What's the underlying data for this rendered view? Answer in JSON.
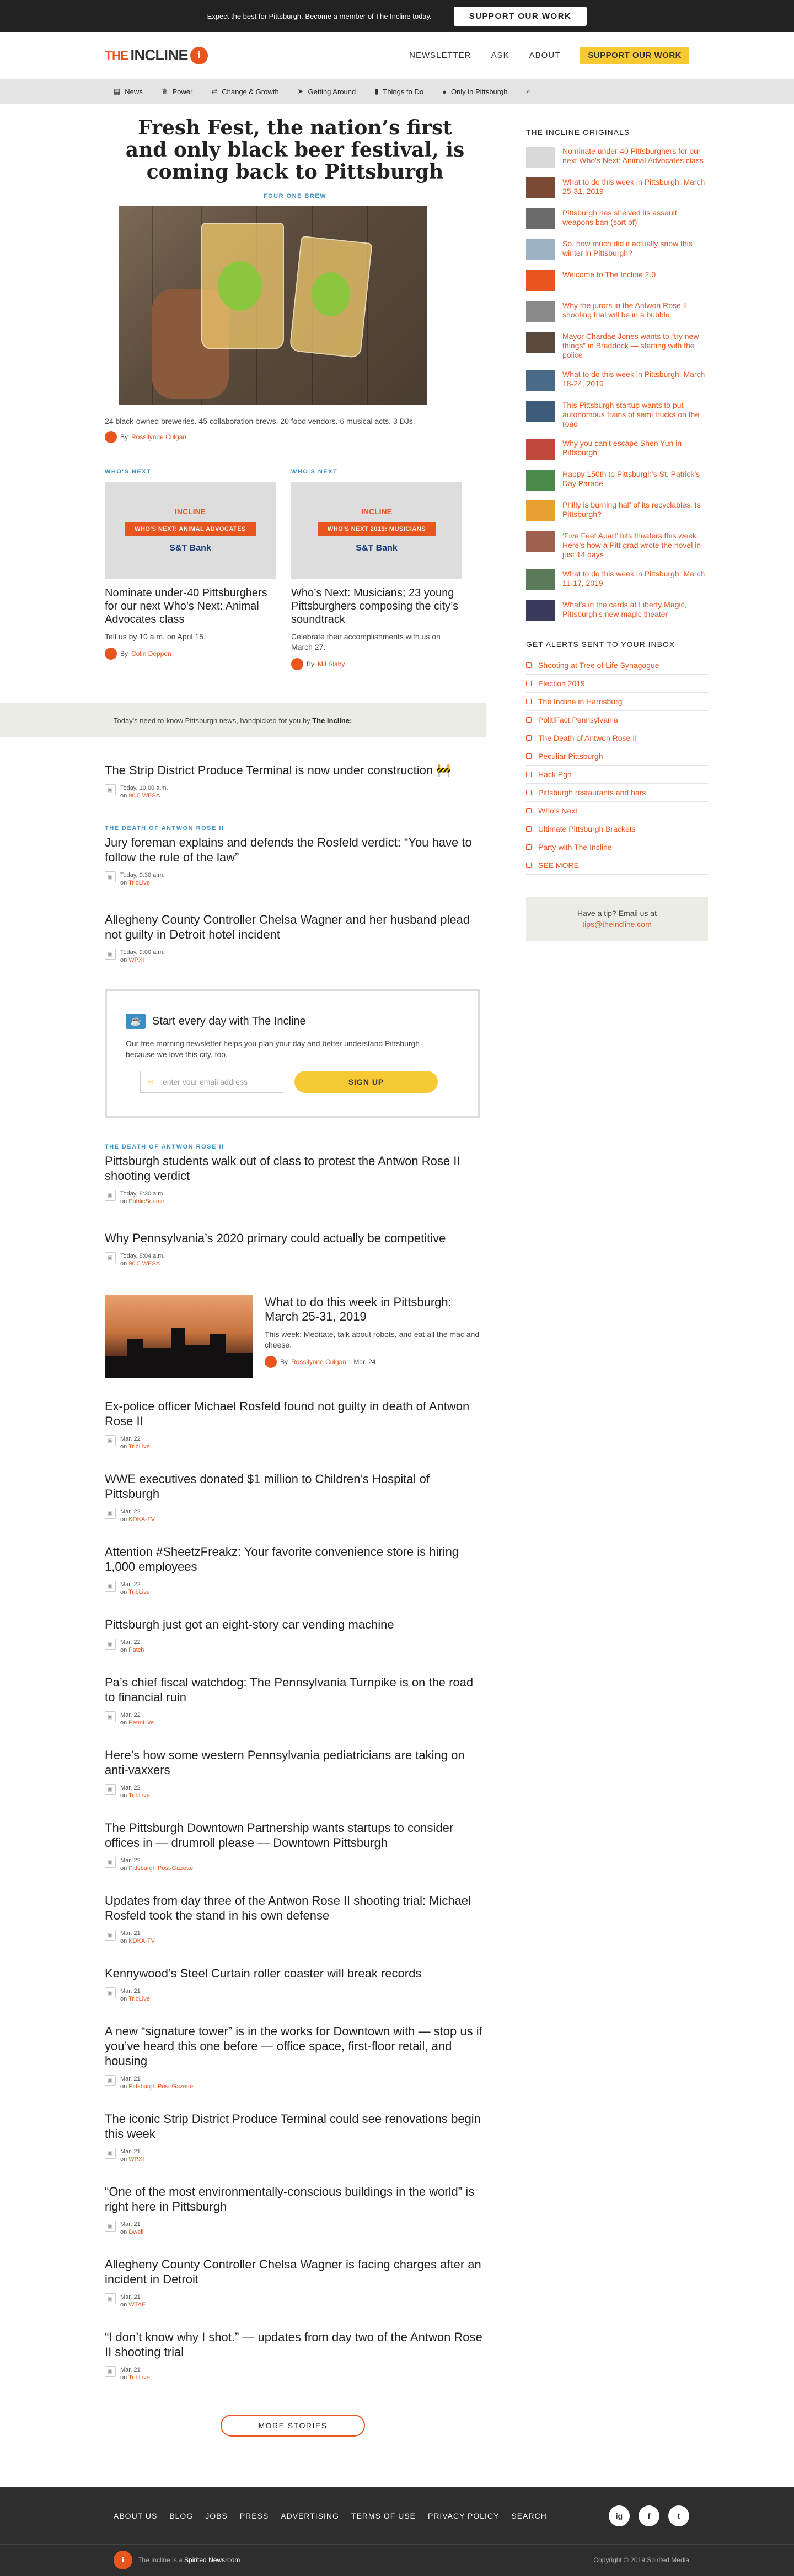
{
  "topbar": {
    "message": "Expect the best for Pittsburgh. Become a member of The Incline today.",
    "button": "Support Our Work"
  },
  "header": {
    "logo_the": "THE",
    "logo_name": "INCLINE",
    "logo_badge": "i",
    "nav": [
      "NEWSLETTER",
      "ASK",
      "ABOUT"
    ],
    "support": "SUPPORT OUR WORK"
  },
  "catnav": [
    {
      "icon": "news-icon",
      "glyph": "▤",
      "label": "News"
    },
    {
      "icon": "power-icon",
      "glyph": "♛",
      "label": "Power"
    },
    {
      "icon": "change-icon",
      "glyph": "⇄",
      "label": "Change & Growth"
    },
    {
      "icon": "getting-around-icon",
      "glyph": "➤",
      "label": "Getting Around"
    },
    {
      "icon": "things-to-do-icon",
      "glyph": "▮",
      "label": "Things to Do"
    },
    {
      "icon": "pittsburgh-icon",
      "glyph": "●",
      "label": "Only in Pittsburgh"
    },
    {
      "icon": "search-icon",
      "glyph": "⌕",
      "label": ""
    }
  ],
  "hero": {
    "title": "Fresh Fest, the nation’s first and only black beer festival, is coming back to Pittsburgh",
    "kicker": "FOUR ONE BREW",
    "description": "24 black-owned breweries. 45 collaboration brews. 20 food vendors. 6 musical acts. 3 DJs.",
    "by": "By",
    "author": "Rossilynne Culgan"
  },
  "whos_next": [
    {
      "kicker": "WHO'S NEXT",
      "banner": "WHO'S NEXT: ANIMAL ADVOCATES",
      "sponsor": "S&T Bank",
      "title": "Nominate under-40 Pittsburghers for our next Who’s Next: Animal Advocates class",
      "desc": "Tell us by 10 a.m. on April 15.",
      "author": "Colin Deppen"
    },
    {
      "kicker": "WHO'S NEXT",
      "banner": "WHO'S NEXT 2019: MUSICIANS",
      "sponsor": "S&T Bank",
      "title": "Who’s Next: Musicians; 23 young Pittsburghers composing the city’s soundtrack",
      "desc": "Celebrate their accomplishments with us on March 27.",
      "author": "MJ Slaby"
    }
  ],
  "promo": {
    "text": "Today's need-to-know Pittsburgh news, handpicked for you by ",
    "brand": "The Incline:"
  },
  "stories_a": [
    {
      "kicker": "",
      "title": "The Strip District Produce Terminal is now under construction 🚧",
      "time": "Today, 10:00 a.m.",
      "src": "90.5 WESA"
    },
    {
      "kicker": "THE DEATH OF ANTWON ROSE II",
      "title": "Jury foreman explains and defends the Rosfeld verdict: “You have to follow the rule of the law”",
      "time": "Today, 9:30 a.m.",
      "src": "TribLive"
    },
    {
      "kicker": "",
      "title": "Allegheny County Controller Chelsa Wagner and her husband plead not guilty in Detroit hotel incident",
      "time": "Today, 9:00 a.m.",
      "src": "WPXI"
    }
  ],
  "newsletter": {
    "title": "Start every day with The Incline",
    "text": "Our free morning newsletter helps you plan your day and better understand Pittsburgh — because we love this city, too.",
    "placeholder": "enter your email address",
    "button": "SIGN UP"
  },
  "stories_b": [
    {
      "kicker": "THE DEATH OF ANTWON ROSE II",
      "title": "Pittsburgh students walk out of class to protest the Antwon Rose II shooting verdict",
      "time": "Today, 8:30 a.m.",
      "src": "PublicSource"
    },
    {
      "kicker": "",
      "title": "Why Pennsylvania’s 2020 primary could actually be competitive",
      "time": "Today, 8:04 a.m.",
      "src": "90.5 WESA"
    }
  ],
  "feature": {
    "title": "What to do this week in Pittsburgh: March 25-31, 2019",
    "desc": "This week: Meditate, talk about robots, and eat all the mac and cheese.",
    "author": "Rossilynne Culgan",
    "date": "Mar. 24"
  },
  "stories_c": [
    {
      "title": "Ex-police officer Michael Rosfeld found not guilty in death of Antwon Rose II",
      "time": "Mar. 22",
      "src": "TribLive"
    },
    {
      "title": "WWE executives donated $1 million to Children’s Hospital of Pittsburgh",
      "time": "Mar. 22",
      "src": "KDKA-TV"
    },
    {
      "title": "Attention #SheetzFreakz: Your favorite convenience store is hiring 1,000 employees",
      "time": "Mar. 22",
      "src": "TribLive"
    },
    {
      "title": "Pittsburgh just got an eight-story car vending machine",
      "time": "Mar. 22",
      "src": "Patch"
    },
    {
      "title": "Pa’s chief fiscal watchdog: The Pennsylvania Turnpike is on the road to financial ruin",
      "time": "Mar. 22",
      "src": "PennLive"
    },
    {
      "title": "Here’s how some western Pennsylvania pediatricians are taking on anti-vaxxers",
      "time": "Mar. 22",
      "src": "TribLive"
    },
    {
      "title": "The Pittsburgh Downtown Partnership wants startups to consider offices in — drumroll please — Downtown Pittsburgh",
      "time": "Mar. 22",
      "src": "Pittsburgh Post-Gazette"
    },
    {
      "title": "Updates from day three of the Antwon Rose II shooting trial: Michael Rosfeld took the stand in his own defense",
      "time": "Mar. 21",
      "src": "KDKA-TV"
    },
    {
      "title": "Kennywood’s Steel Curtain roller coaster will break records",
      "time": "Mar. 21",
      "src": "TribLive"
    },
    {
      "title": "A new “signature tower” is in the works for Downtown with — stop us if you’ve heard this one before — office space, first-floor retail, and housing",
      "time": "Mar. 21",
      "src": "Pittsburgh Post-Gazette"
    },
    {
      "title": "The iconic Strip District Produce Terminal could see renovations begin this week",
      "time": "Mar. 21",
      "src": "WPXI"
    },
    {
      "title": "“One of the most environmentally-conscious buildings in the world” is right here in Pittsburgh",
      "time": "Mar. 21",
      "src": "Dwell"
    },
    {
      "title": "Allegheny County Controller Chelsa Wagner is facing charges after an incident in Detroit",
      "time": "Mar. 21",
      "src": "WTAE"
    },
    {
      "title": "“I don’t know why I shot.” — updates from day two of the Antwon Rose II shooting trial",
      "time": "Mar. 21",
      "src": "TribLive"
    }
  ],
  "more_button": "MORE STORIES",
  "sidebar": {
    "originals_title": "THE INCLINE ORIGINALS",
    "originals": [
      {
        "title": "Nominate under-40 Pittsburghers for our next Who’s Next: Animal Advocates class",
        "color": "#d9d9d9"
      },
      {
        "title": "What to do this week in Pittsburgh: March 25-31, 2019",
        "color": "#7a4a34"
      },
      {
        "title": "Pittsburgh has shelved its assault weapons ban (sort of)",
        "color": "#6b6b6b"
      },
      {
        "title": "So, how much did it actually snow this winter in Pittsburgh?",
        "color": "#9eb2c5"
      },
      {
        "title": "Welcome to The Incline 2.0",
        "color": "#e8551f"
      },
      {
        "title": "Why the jurors in the Antwon Rose II shooting trial will be in a bubble",
        "color": "#8a8a8a"
      },
      {
        "title": "Mayor Chardae Jones wants to “try new things” in Braddock — starting with the police",
        "color": "#5a4a3e"
      },
      {
        "title": "What to do this week in Pittsburgh: March 18-24, 2019",
        "color": "#4a6a8a"
      },
      {
        "title": "This Pittsburgh startup wants to put autonomous trains of semi trucks on the road",
        "color": "#3c5c7a"
      },
      {
        "title": "Why you can’t escape Shen Yun in Pittsburgh",
        "color": "#c04a3a"
      },
      {
        "title": "Happy 150th to Pittsburgh’s St. Patrick’s Day Parade",
        "color": "#4a8a4a"
      },
      {
        "title": "Philly is burning half of its recyclables. Is Pittsburgh?",
        "color": "#e8a030"
      },
      {
        "title": "‘Five Feet Apart’ hits theaters this week. Here’s how a Pitt grad wrote the novel in just 14 days",
        "color": "#a06050"
      },
      {
        "title": "What to do this week in Pittsburgh: March 11-17, 2019",
        "color": "#5a7a5a"
      },
      {
        "title": "What’s in the cards at Liberty Magic, Pittsburgh’s new magic theater",
        "color": "#3a3a5a"
      }
    ],
    "alerts_title": "GET ALERTS SENT TO YOUR INBOX",
    "alerts": [
      "Shooting at Tree of Life Synagogue",
      "Election 2019",
      "The Incline in Harrisburg",
      "PolitiFact Pennsylvania",
      "The Death of Antwon Rose II",
      "Peculiar Pittsburgh",
      "Hack Pgh",
      "Pittsburgh restaurants and bars",
      "Who's Next",
      "Ultimate Pittsburgh Brackets",
      "Party with The Incline",
      "SEE MORE"
    ],
    "tip_line": "Have a tip? Email us at",
    "tip_email": "tips@theincline.com"
  },
  "footer": {
    "links": [
      "ABOUT US",
      "BLOG",
      "JOBS",
      "PRESS",
      "ADVERTISING",
      "TERMS OF USE",
      "PRIVACY POLICY",
      "SEARCH"
    ],
    "social": [
      "ig",
      "f",
      "t"
    ],
    "bottom_text": "The Incline is a ",
    "bottom_brand": "Spirited Newsroom",
    "copyright": "Copyright © 2019 Spirited Media"
  },
  "colors": {
    "accent": "#e8551f",
    "link_blue": "#3b8fc5",
    "yellow": "#f6c935"
  }
}
